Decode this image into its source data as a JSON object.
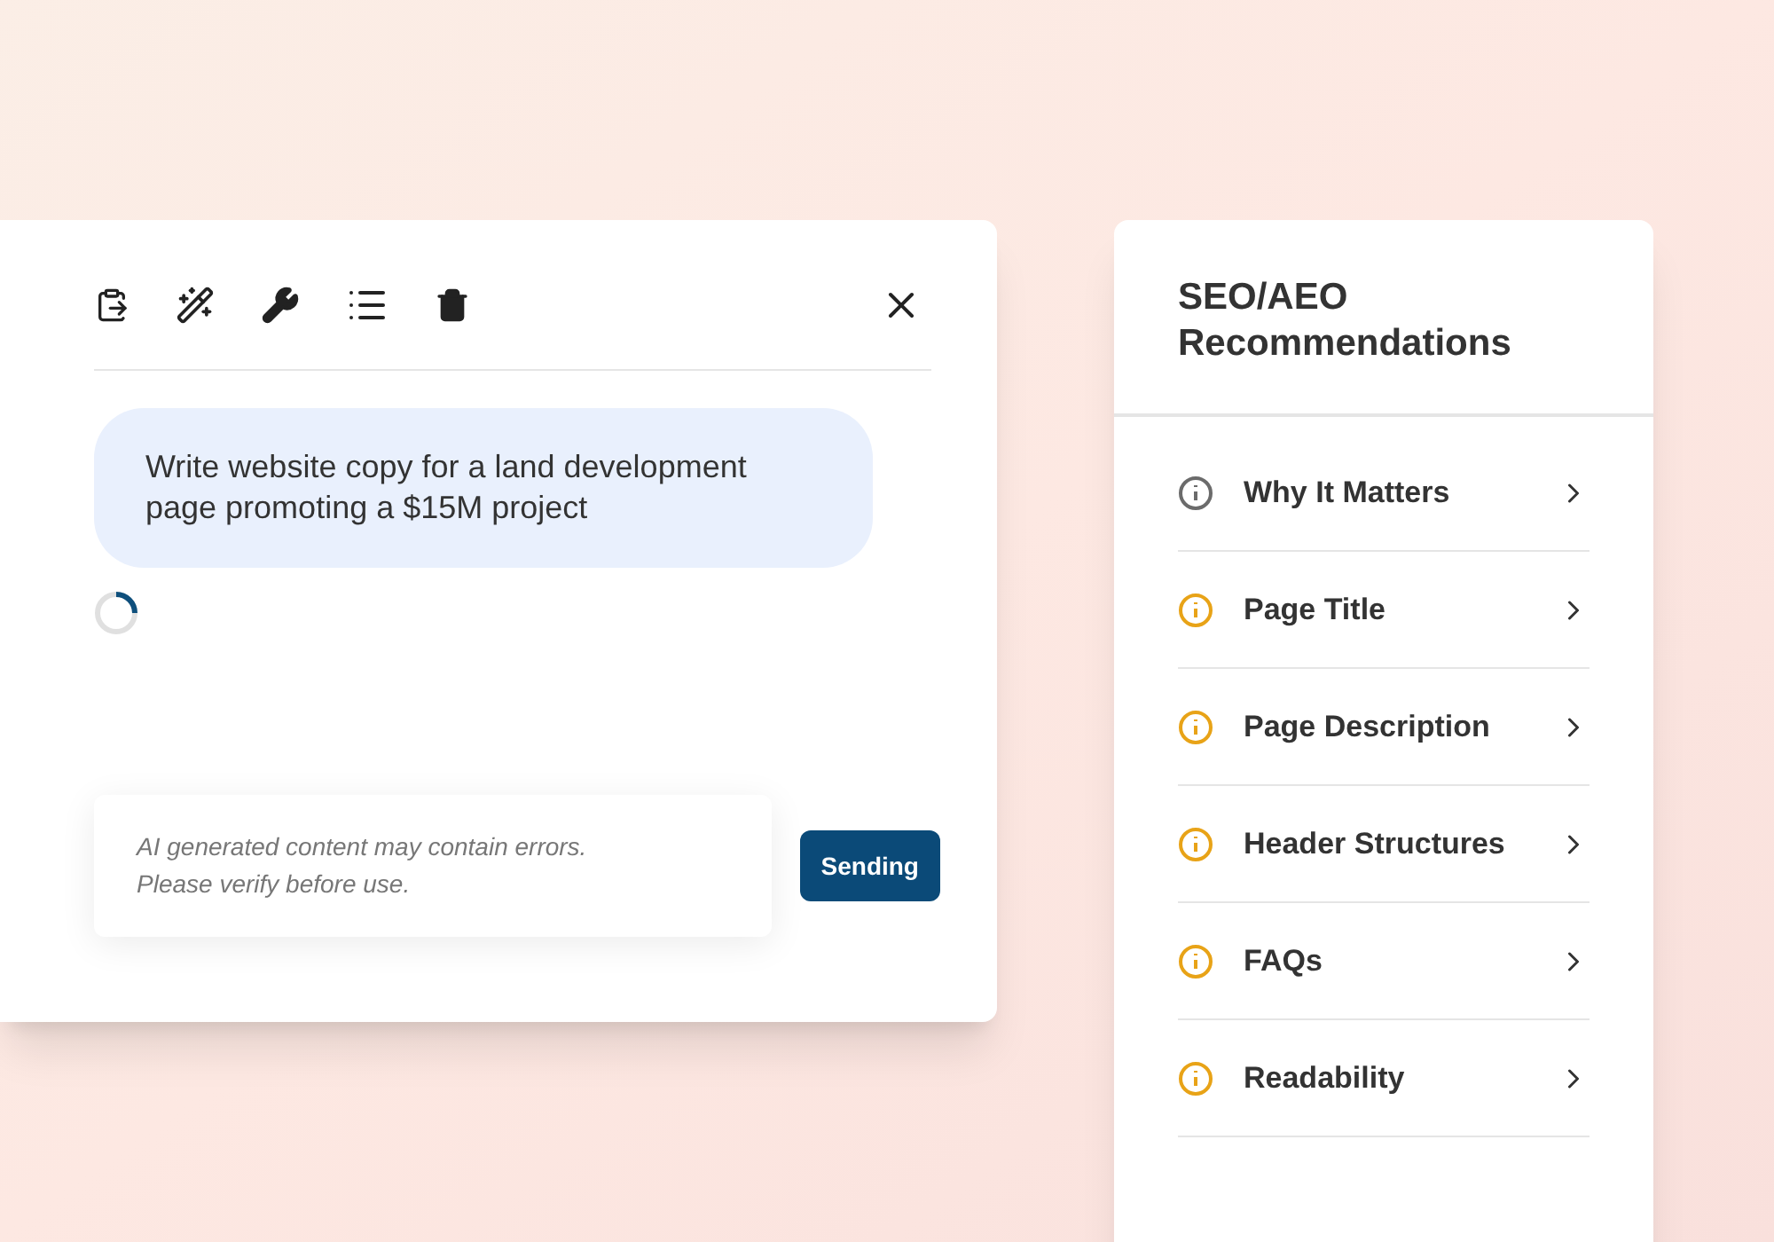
{
  "chat": {
    "message": "Write website copy for a land development page promoting a $15M project",
    "loading": true,
    "input": {
      "placeholder": "AI generated content may contain errors. Please verify before use."
    },
    "send_button": "Sending"
  },
  "recommendations": {
    "title": "SEO/AEO Recommendations",
    "items": [
      {
        "label": "Why It Matters",
        "color": "#6b6b6b"
      },
      {
        "label": "Page Title",
        "color": "#e8a317"
      },
      {
        "label": "Page Description",
        "color": "#e8a317"
      },
      {
        "label": "Header Structures",
        "color": "#e8a317"
      },
      {
        "label": "FAQs",
        "color": "#e8a317"
      },
      {
        "label": "Readability",
        "color": "#e8a317"
      }
    ]
  }
}
